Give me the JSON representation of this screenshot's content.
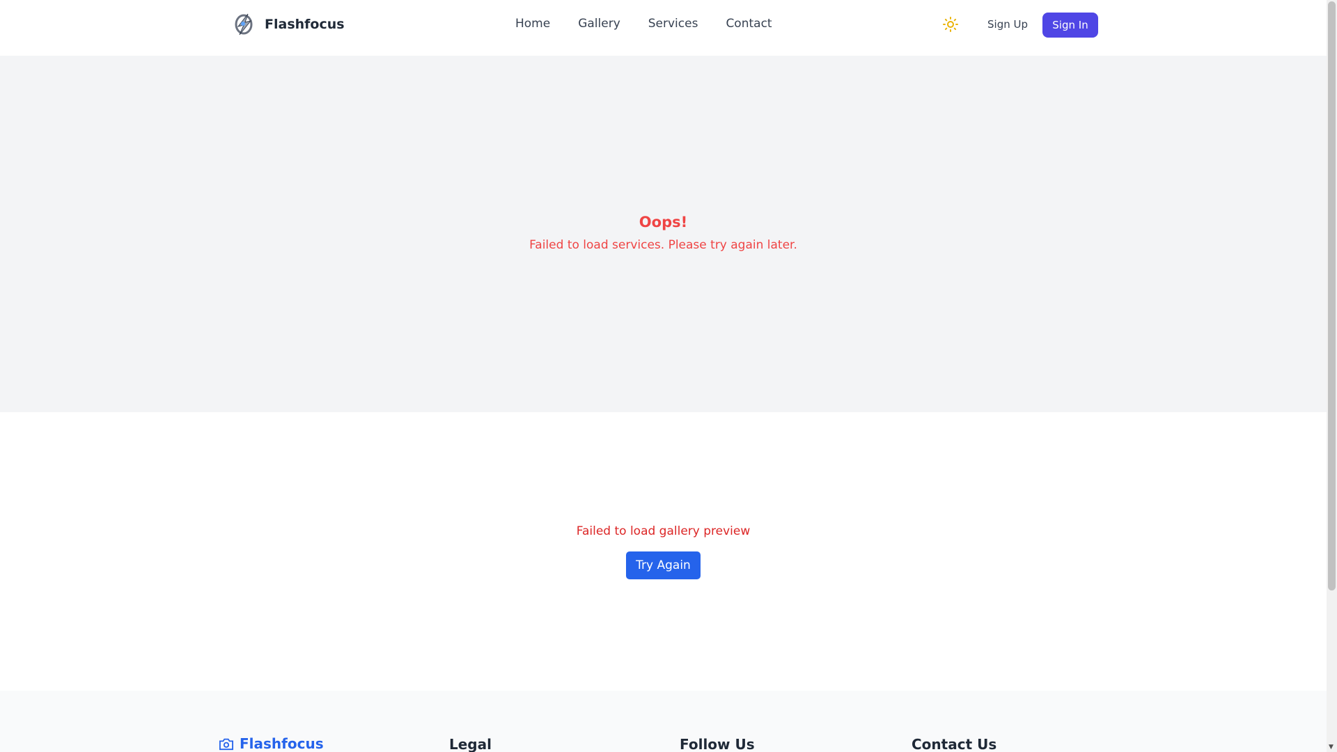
{
  "header": {
    "brand": "Flashfocus",
    "nav": [
      "Home",
      "Gallery",
      "Services",
      "Contact"
    ],
    "sign_up": "Sign Up",
    "sign_in": "Sign In"
  },
  "services": {
    "title": "Oops!",
    "message": "Failed to load services. Please try again later."
  },
  "gallery": {
    "message": "Failed to load gallery preview",
    "retry": "Try Again"
  },
  "footer": {
    "brand": "Flashfocus",
    "headings": [
      "Legal",
      "Follow Us",
      "Contact Us"
    ]
  },
  "colors": {
    "primary": "#4f46e5",
    "error": "#ef4444",
    "button": "#2563eb",
    "sun": "#eab308"
  }
}
